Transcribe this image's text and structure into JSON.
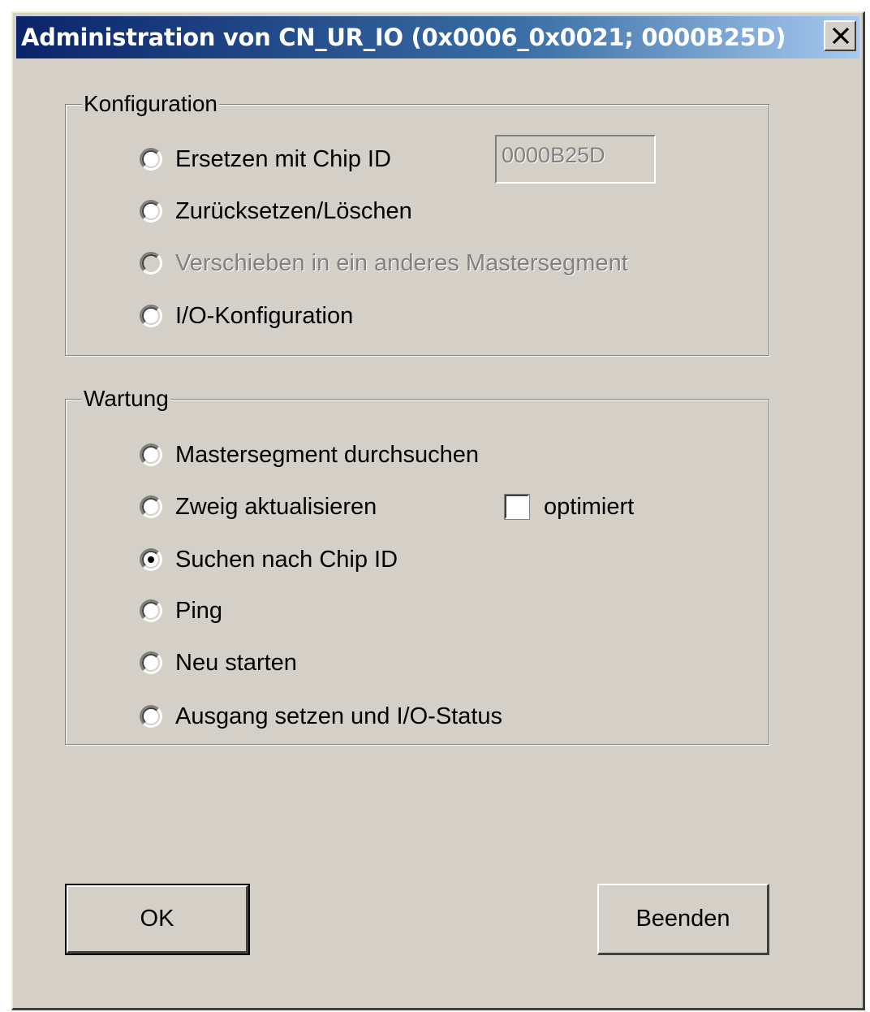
{
  "window": {
    "title": "Administration von CN_UR_IO (0x0006_0x0021; 0000B25D)",
    "close_symbol": "X"
  },
  "konfiguration": {
    "legend": "Konfiguration",
    "options": [
      {
        "label": "Ersetzen mit Chip ID",
        "selected": false,
        "disabled": false
      },
      {
        "label": "Zurücksetzen/Löschen",
        "selected": false,
        "disabled": false
      },
      {
        "label": "Verschieben in ein anderes Mastersegment",
        "selected": false,
        "disabled": true
      },
      {
        "label": "I/O-Konfiguration",
        "selected": false,
        "disabled": false
      }
    ],
    "chip_id_value": "0000B25D"
  },
  "wartung": {
    "legend": "Wartung",
    "options": [
      {
        "label": "Mastersegment durchsuchen",
        "selected": false
      },
      {
        "label": "Zweig aktualisieren",
        "selected": false
      },
      {
        "label": "Suchen nach Chip ID",
        "selected": true
      },
      {
        "label": "Ping",
        "selected": false
      },
      {
        "label": "Neu starten",
        "selected": false
      },
      {
        "label": "Ausgang setzen und I/O-Status",
        "selected": false
      }
    ],
    "optimiert_label": "optimiert",
    "optimiert_checked": false
  },
  "buttons": {
    "ok_label": "OK",
    "beenden_label": "Beenden"
  }
}
